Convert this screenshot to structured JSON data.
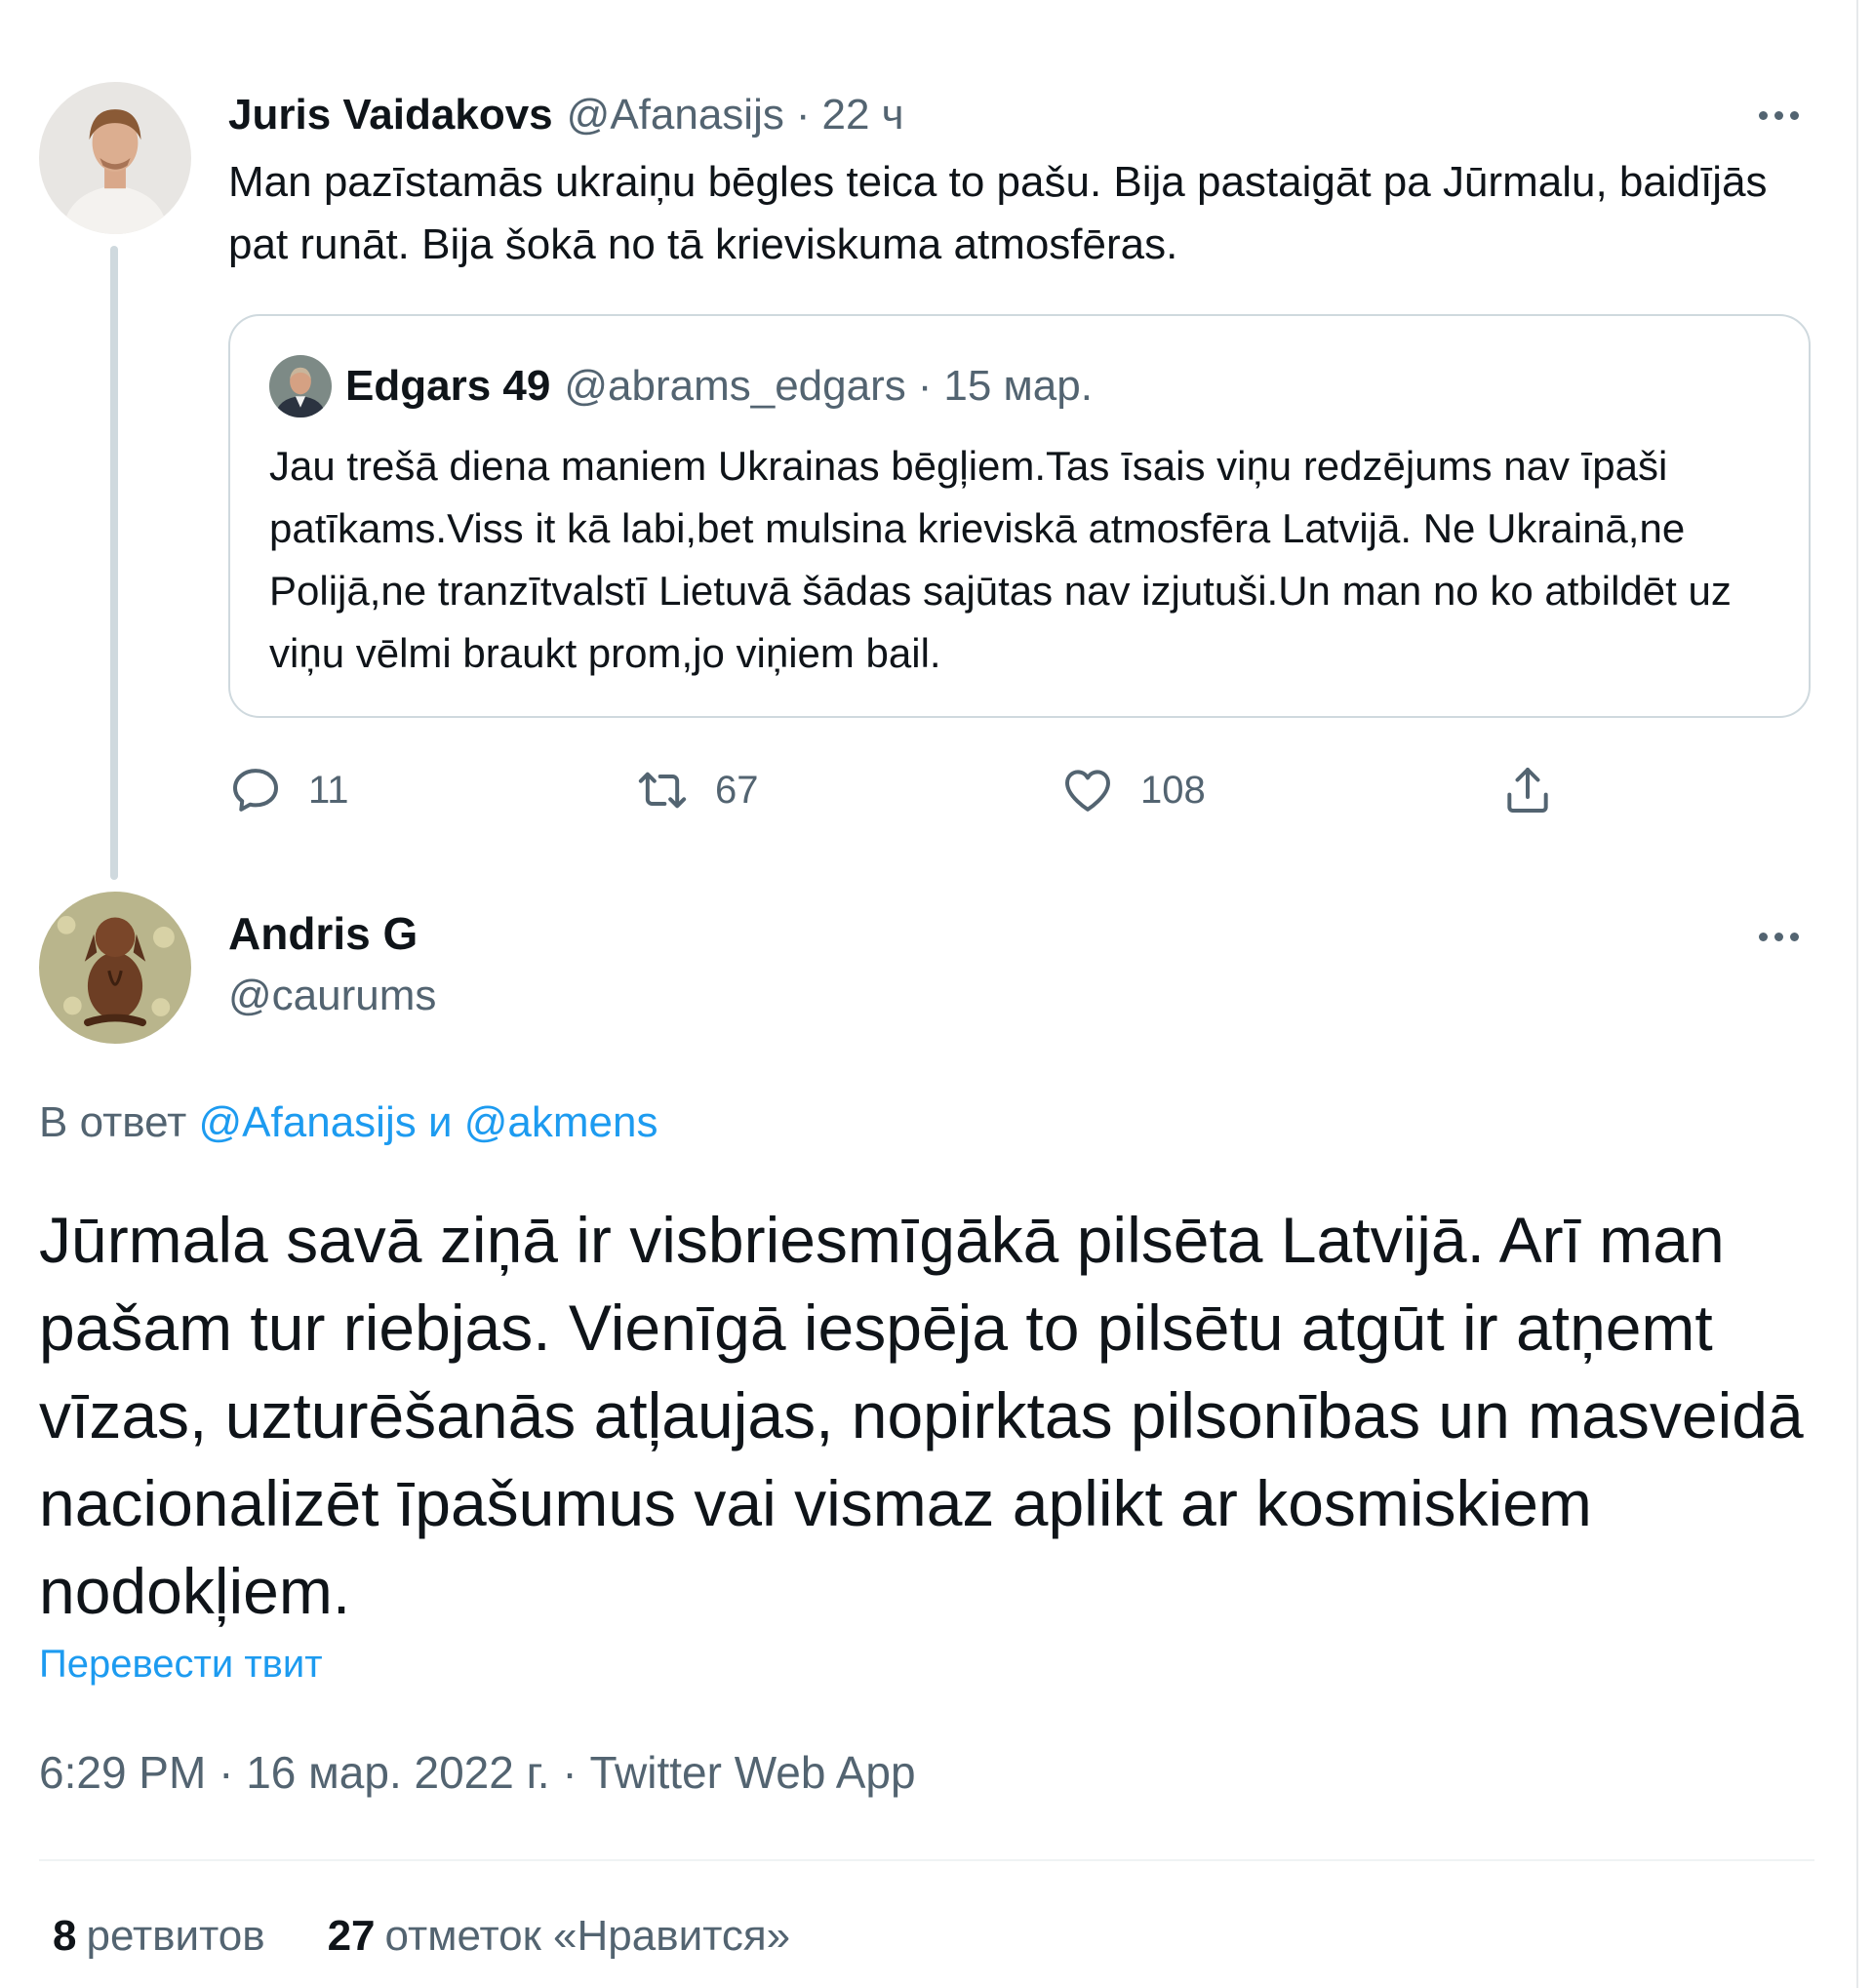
{
  "parent_tweet": {
    "author_name": "Juris Vaidakovs",
    "handle": "@Afanasijs",
    "separator": "·",
    "time": "22 ч",
    "text": "Man pazīstamās ukraiņu bēgles teica to pašu. Bija pastaigāt pa Jūrmalu, baidījās pat runāt. Bija šokā no tā krieviskuma atmosfēras.",
    "quoted": {
      "author_name": "Edgars 49",
      "handle": "@abrams_edgars",
      "separator": "·",
      "time": "15 мар.",
      "text": "Jau trešā diena maniem Ukrainas bēgļiem.Tas īsais viņu redzējums nav īpaši patīkams.Viss it kā labi,bet mulsina krieviskā  atmosfēra Latvijā. Ne Ukrainā,ne Polijā,ne tranzītvalstī Lietuvā šādas sajūtas nav izjutuši.Un man no ko atbildēt uz viņu vēlmi braukt prom,jo viņiem bail."
    },
    "actions": {
      "replies": "11",
      "retweets": "67",
      "likes": "108"
    }
  },
  "reply_tweet": {
    "author_name": "Andris G",
    "handle": "@caurums",
    "replying_prefix": "В ответ",
    "replying_to_1": "@Afanasijs",
    "replying_and": "и",
    "replying_to_2": "@akmens",
    "text": "Jūrmala savā ziņā ir visbriesmīgākā pilsēta Latvijā. Arī man pašam tur riebjas. Vienīgā iespēja to pilsētu atgūt ir atņemt vīzas, uzturēšanās atļaujas, nopirktas pilsonības un masveidā nacionalizēt īpašumus vai vismaz aplikt ar kosmiskiem nodokļiem.",
    "translate_label": "Перевести твит",
    "time": "6:29 PM",
    "date": "16 мар. 2022 г.",
    "meta_separator": "·",
    "source": "Twitter Web App",
    "retweet_count": "8",
    "retweet_label": "ретвитов",
    "like_count": "27",
    "like_label": "отметок «Нравится»"
  },
  "icons": {
    "more": "more-horizontal-icon",
    "reply": "reply-bubble-icon",
    "retweet": "retweet-icon",
    "like": "heart-icon",
    "share": "share-upload-icon"
  },
  "colors": {
    "text_primary": "#0f1419",
    "text_secondary": "#536471",
    "link": "#1d9bf0",
    "border": "#cfd9de"
  }
}
